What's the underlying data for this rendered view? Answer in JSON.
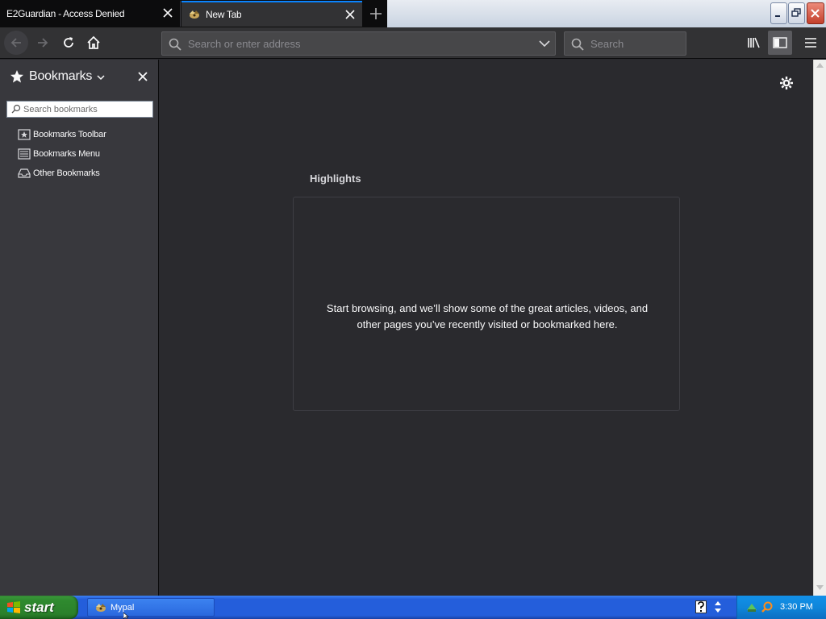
{
  "tabs": [
    {
      "label": "E2Guardian - Access Denied"
    },
    {
      "label": "New Tab"
    }
  ],
  "toolbar": {
    "url_placeholder": "Search or enter address",
    "search_placeholder": "Search"
  },
  "sidebar": {
    "title": "Bookmarks",
    "search_placeholder": "Search bookmarks",
    "items": [
      {
        "label": "Bookmarks Toolbar",
        "icon": "star-folder-icon"
      },
      {
        "label": "Bookmarks Menu",
        "icon": "menu-list-icon"
      },
      {
        "label": "Other Bookmarks",
        "icon": "tray-folder-icon"
      }
    ]
  },
  "content": {
    "highlights_title": "Highlights",
    "highlights_message": "Start browsing, and we’ll show some of the great articles, videos, and other pages you’ve recently visited or bookmarked here."
  },
  "taskbar": {
    "start_label": "start",
    "task_label": "Mypal",
    "clock": "3:30 PM"
  },
  "colors": {
    "accent": "#0a84ff",
    "content_bg": "#2a2a2e",
    "sidebar_bg": "#38383d",
    "toolbar_bg": "#323234"
  }
}
